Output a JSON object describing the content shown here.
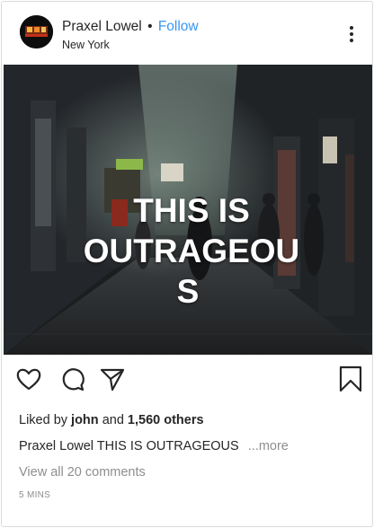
{
  "header": {
    "username": "Praxel Lowel",
    "separator": "•",
    "follow_label": "Follow",
    "location": "New York",
    "more_icon": "more-vertical-icon"
  },
  "post": {
    "overlay_lines": [
      "THIS IS",
      "OUTRAGEOU",
      "S"
    ]
  },
  "actions": {
    "icons": [
      "heart-icon",
      "comment-icon",
      "share-icon",
      "bookmark-icon"
    ]
  },
  "likes": {
    "prefix": "Liked by",
    "user": "john",
    "middle": "and",
    "count": "1,560 others"
  },
  "caption": {
    "username": "Praxel Lowel",
    "text": "THIS IS OUTRAGEOUS",
    "more": "...more"
  },
  "comments": {
    "view_all": "View all 20 comments"
  },
  "timestamp": "5 MINS",
  "colors": {
    "accent": "#3897f0",
    "text": "#262626",
    "muted": "#8e8e8e"
  }
}
